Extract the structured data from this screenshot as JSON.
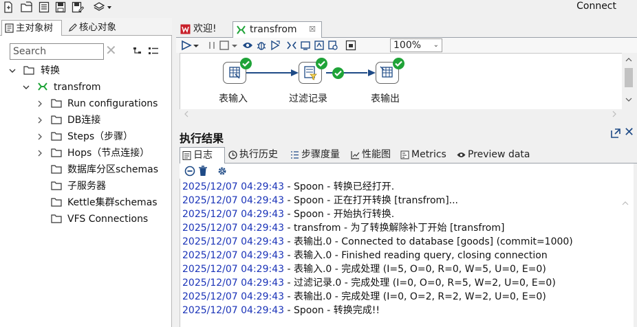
{
  "topbar": {
    "connect_label": "Connect",
    "icons": [
      "new-file-icon",
      "open-file-icon",
      "explore-repository-icon",
      "save-icon",
      "save-as-icon",
      "layers-icon"
    ]
  },
  "left_panel": {
    "tabs": [
      {
        "label": "主对象树",
        "icon": "tree-icon"
      },
      {
        "label": "核心对象",
        "icon": "pencil-icon"
      }
    ],
    "search": {
      "placeholder": "Search",
      "clear_glyph": "✕"
    },
    "tree": [
      {
        "label": "转换",
        "level": 0,
        "icon": "folder-icon",
        "expanded": true
      },
      {
        "label": "transfrom",
        "level": 1,
        "icon": "transformation-icon",
        "expanded": true
      },
      {
        "label": "Run configurations",
        "level": 2,
        "icon": "folder-icon",
        "expandable": true
      },
      {
        "label": "DB连接",
        "level": 2,
        "icon": "folder-icon",
        "expandable": true
      },
      {
        "label": "Steps（步骤）",
        "level": 2,
        "icon": "folder-icon",
        "expandable": true
      },
      {
        "label": "Hops（节点连接）",
        "level": 2,
        "icon": "folder-icon",
        "expandable": true
      },
      {
        "label": "数据库分区schemas",
        "level": 2,
        "icon": "folder-icon",
        "expandable": false
      },
      {
        "label": "子服务器",
        "level": 2,
        "icon": "folder-icon",
        "expandable": false
      },
      {
        "label": "Kettle集群schemas",
        "level": 2,
        "icon": "folder-icon",
        "expandable": false
      },
      {
        "label": "VFS Connections",
        "level": 2,
        "icon": "folder-icon",
        "expandable": false
      }
    ]
  },
  "editor": {
    "tabs": [
      {
        "label": "欢迎!",
        "icon": "welcome-icon"
      },
      {
        "label": "transfrom",
        "icon": "transformation-icon",
        "close_glyph": "☒"
      }
    ],
    "zoom": "100%",
    "steps": [
      {
        "label": "表输入",
        "icon": "table-input-icon"
      },
      {
        "label": "过滤记录",
        "icon": "filter-rows-icon"
      },
      {
        "label": "表输出",
        "icon": "table-output-icon"
      }
    ]
  },
  "results": {
    "title": "执行结果",
    "close_glyph": "✕",
    "tabs": [
      {
        "label": "日志",
        "icon": "log-icon"
      },
      {
        "label": "执行历史",
        "icon": "history-icon"
      },
      {
        "label": "步骤度量",
        "icon": "step-metrics-icon"
      },
      {
        "label": "性能图",
        "icon": "performance-chart-icon"
      },
      {
        "label": "Metrics",
        "icon": "metrics-icon"
      },
      {
        "label": "Preview data",
        "icon": "preview-eye-icon"
      }
    ],
    "log": [
      {
        "ts": "2025/12/07 04:29:43",
        "msg": " - Spoon - 转换已经打开."
      },
      {
        "ts": "2025/12/07 04:29:43",
        "msg": " - Spoon - 正在打开转换 [transfrom]..."
      },
      {
        "ts": "2025/12/07 04:29:43",
        "msg": " - Spoon - 开始执行转换."
      },
      {
        "ts": "2025/12/07 04:29:43",
        "msg": " - transfrom - 为了转换解除补丁开始  [transfrom]"
      },
      {
        "ts": "2025/12/07 04:29:43",
        "msg": " - 表输出.0 - Connected to database [goods] (commit=1000)"
      },
      {
        "ts": "2025/12/07 04:29:43",
        "msg": " - 表输入.0 - Finished reading query, closing connection"
      },
      {
        "ts": "2025/12/07 04:29:43",
        "msg": " - 表输入.0 - 完成处理 (I=5, O=0, R=0, W=5, U=0, E=0)"
      },
      {
        "ts": "2025/12/07 04:29:43",
        "msg": " - 过滤记录.0 - 完成处理 (I=0, O=0, R=5, W=2, U=0, E=0)"
      },
      {
        "ts": "2025/12/07 04:29:43",
        "msg": " - 表输出.0 - 完成处理 (I=0, O=2, R=2, W=2, U=0, E=0)"
      },
      {
        "ts": "2025/12/07 04:29:43",
        "msg": " - Spoon - 转换完成!!"
      }
    ]
  },
  "colors": {
    "timestamp": "#1a33b8",
    "success_check": "#1fa338",
    "hop_arrow": "#1e4a86",
    "transformation_green": "#1fa338"
  }
}
